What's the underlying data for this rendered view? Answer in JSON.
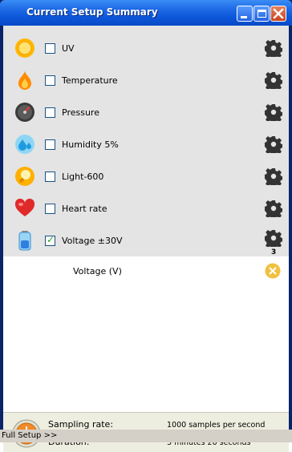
{
  "window": {
    "title": "Current Setup Summary",
    "buttons": [
      "minimize",
      "maximize",
      "close"
    ]
  },
  "sensors": [
    {
      "label": "UV",
      "checked": false,
      "icon": "sun-icon"
    },
    {
      "label": "Temperature",
      "checked": false,
      "icon": "flame-icon"
    },
    {
      "label": "Pressure",
      "checked": false,
      "icon": "gauge-icon"
    },
    {
      "label": "Humidity 5%",
      "checked": false,
      "icon": "water-drops-icon"
    },
    {
      "label": "Light-600",
      "checked": false,
      "icon": "lightbulb-icon"
    },
    {
      "label": "Heart rate",
      "checked": false,
      "icon": "heart-icon"
    },
    {
      "label": "Voltage ±30V",
      "checked": true,
      "icon": "battery-icon",
      "badge": "3"
    }
  ],
  "active_channel": {
    "label": "Voltage (V)"
  },
  "sampling": {
    "rate_label": "Sampling rate:",
    "rate_value": "1000 samples per second",
    "duration_label": "Duration:",
    "duration_value": "3 minutes 20 seconds"
  },
  "footer": {
    "full_setup_link": "Full Setup >>"
  },
  "colors": {
    "title_bar": "#0b55d8",
    "sensor_panel_bg": "#e4e4e4",
    "footer_bg": "#eeeee0",
    "remove_button": "#f0c040"
  }
}
